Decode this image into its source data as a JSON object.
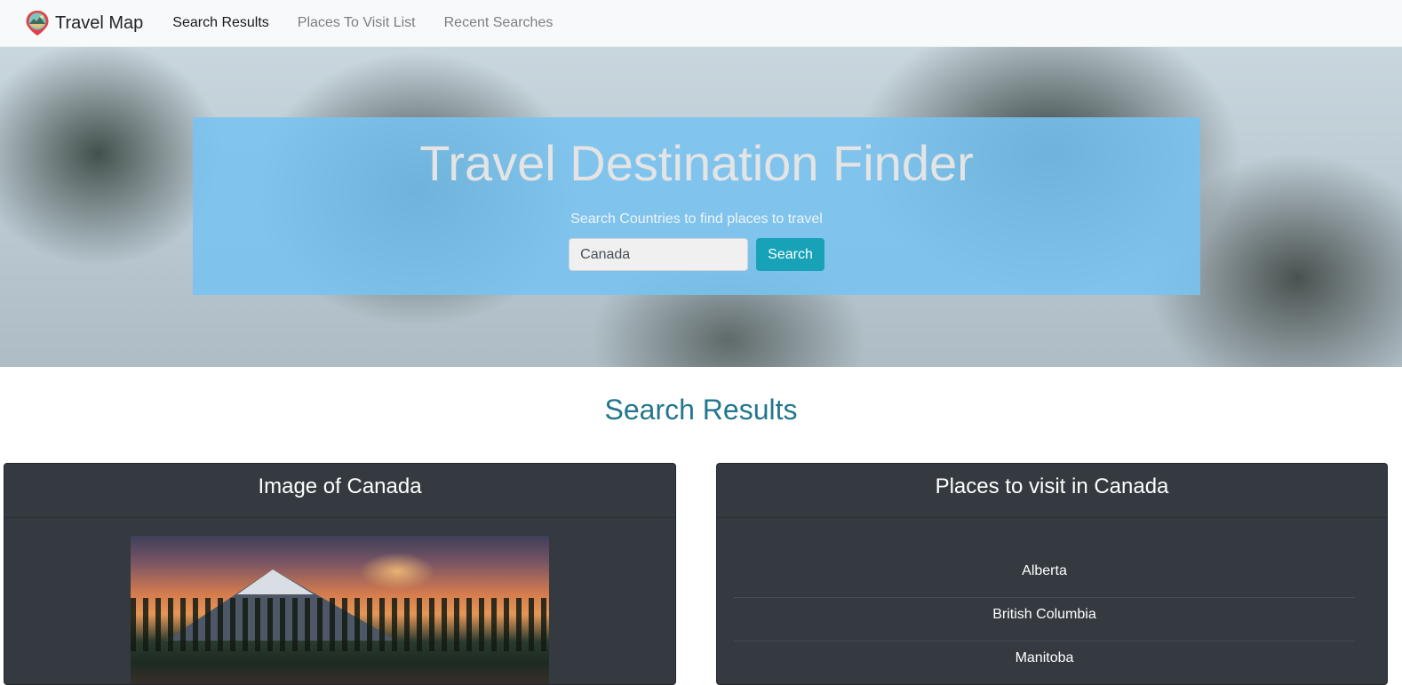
{
  "navbar": {
    "brand": "Travel Map",
    "brand_icon": "map-pin-landscape-icon",
    "links": [
      {
        "label": "Search Results",
        "active": true
      },
      {
        "label": "Places To Visit List",
        "active": false
      },
      {
        "label": "Recent Searches",
        "active": false
      }
    ]
  },
  "hero": {
    "title": "Travel Destination Finder",
    "subtitle": "Search Countries to find places to travel",
    "search_value": "Canada",
    "search_button": "Search"
  },
  "results": {
    "heading": "Search Results",
    "image_card_title": "Image of Canada",
    "places_card_title": "Places to visit in Canada",
    "places": [
      "Alberta",
      "British Columbia",
      "Manitoba"
    ]
  },
  "colors": {
    "navbar_bg": "#f8f9fa",
    "hero_panel": "#78c3f0",
    "search_button": "#17a2b8",
    "heading": "#24768e",
    "card_bg": "#343a40"
  }
}
